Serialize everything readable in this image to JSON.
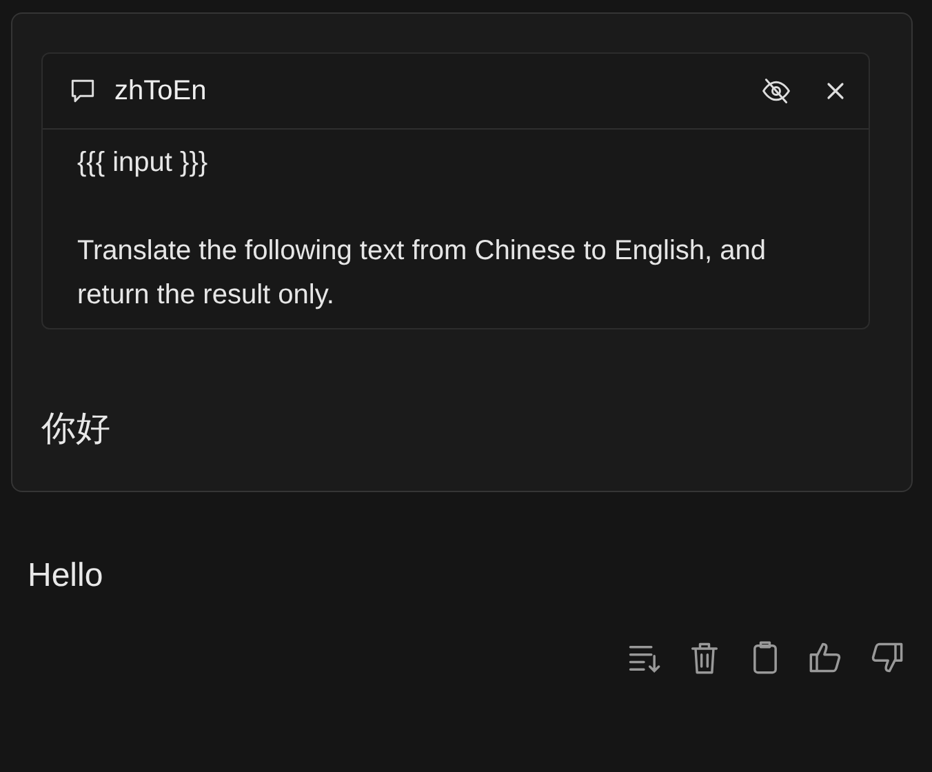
{
  "prompt_card": {
    "title": "zhToEn",
    "text": "{{{ input }}}\n\nTranslate the following text from Chinese to English, and return the result only."
  },
  "user_message": "你好",
  "reply": "Hello"
}
